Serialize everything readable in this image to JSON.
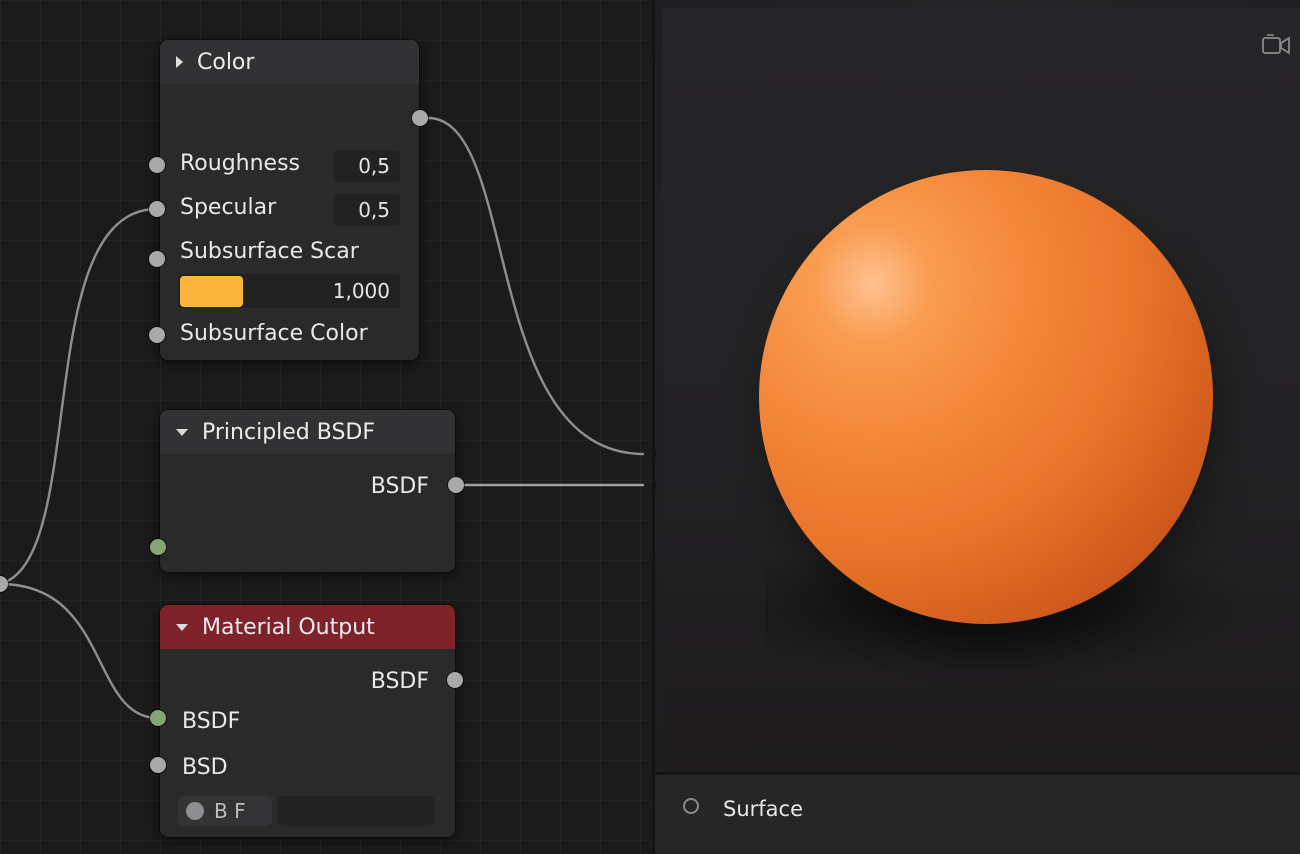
{
  "nodes": {
    "color": {
      "title": "Color",
      "inputs": {
        "roughness": {
          "label": "Roughness",
          "value": "0,5"
        },
        "specular": {
          "label": "Specular",
          "value": "0,5"
        },
        "subsurface_scale": {
          "label": "Subsurface Scar",
          "value": "1,000",
          "swatch_color": "#fbb53a"
        },
        "subsurface_color": {
          "label": "Subsurface Color"
        }
      }
    },
    "principled_bsdf": {
      "title": "Principled BSDF",
      "output_label": "BSDF"
    },
    "material_output": {
      "title": "Material Output",
      "header_color": "#7d2329",
      "output_label": "BSDF",
      "input_bsdf_label": "BSDF",
      "input_bsd_label": "BSD",
      "dropdown_label": "B  F"
    }
  },
  "viewport": {
    "sphere_color": "#f4893b",
    "camera_icon": "camera-icon"
  },
  "properties": {
    "surface_label": "Surface"
  },
  "colors": {
    "socket_grey": "#a9a9ab",
    "socket_green": "#87a474"
  }
}
